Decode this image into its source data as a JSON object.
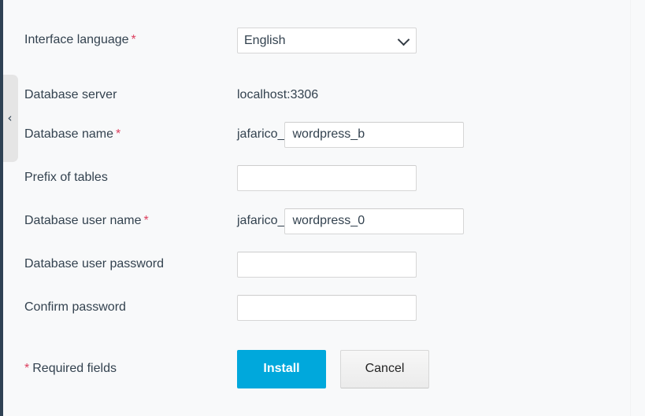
{
  "sidebar": {
    "collapse_handle_icon": "chevron-left-icon",
    "collapse_handle_glyph": "‹"
  },
  "form": {
    "rows": [
      {
        "id": "interface-language",
        "label": "Interface language",
        "required": true,
        "type": "select",
        "value": "English",
        "options": [
          "English"
        ],
        "chevron_icon": "chevron-down-icon"
      },
      {
        "id": "database-server",
        "label": "Database server",
        "required": false,
        "type": "static",
        "value": "localhost:3306"
      },
      {
        "id": "database-name",
        "label": "Database name",
        "required": true,
        "type": "prefixed-text",
        "prefix": "jafarico_",
        "value": "wordpress_b",
        "placeholder": ""
      },
      {
        "id": "prefix-of-tables",
        "label": "Prefix of tables",
        "required": false,
        "type": "text",
        "value": "",
        "placeholder": ""
      },
      {
        "id": "database-user-name",
        "label": "Database user name",
        "required": true,
        "type": "prefixed-text",
        "prefix": "jafarico_",
        "value": "wordpress_0",
        "placeholder": ""
      },
      {
        "id": "database-user-password",
        "label": "Database user password",
        "required": false,
        "type": "password",
        "value": "",
        "placeholder": ""
      },
      {
        "id": "confirm-password",
        "label": "Confirm password",
        "required": false,
        "type": "password",
        "value": "",
        "placeholder": ""
      }
    ],
    "required_marker": "*",
    "required_note_text": "Required fields",
    "buttons": {
      "install_label": "Install",
      "cancel_label": "Cancel"
    }
  },
  "colors": {
    "page_background": "#f8f9fa",
    "rail": "#2f4254",
    "handle": "#e5e5e5",
    "text": "#33424f",
    "required_star": "#dc3f5e",
    "primary_button": "#00a8dc",
    "primary_button_text": "#ffffff",
    "secondary_button": "#efefef",
    "input_border": "#d6d6d6"
  }
}
